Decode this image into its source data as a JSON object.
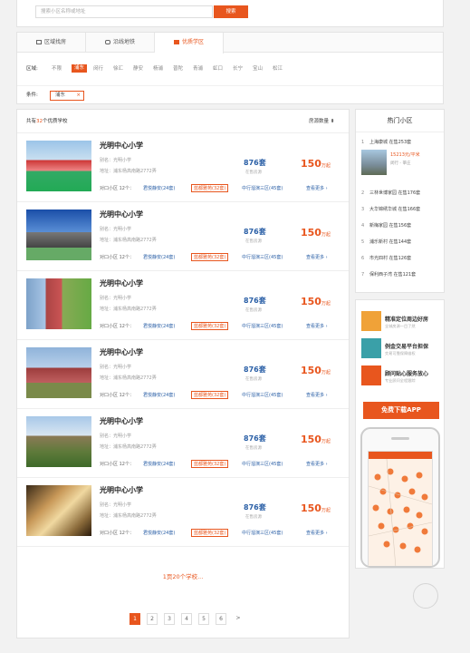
{
  "search": {
    "placeholder": "搜索小区名称或地址",
    "button": "搜索"
  },
  "tabs": [
    {
      "label": "区域找房",
      "icon": "map-icon"
    },
    {
      "label": "沿线地铁",
      "icon": "subway-icon"
    },
    {
      "label": "优质学区",
      "icon": "school-icon"
    }
  ],
  "filter": {
    "district_label": "区域:",
    "districts": [
      "不限",
      "浦东",
      "闵行",
      "徐汇",
      "静安",
      "杨浦",
      "普陀",
      "青浦",
      "虹口",
      "长宁",
      "宝山",
      "松江"
    ],
    "selected_district": "浦东",
    "condition_label": "条件:",
    "condition_tag": "浦东"
  },
  "list": {
    "count_prefix": "共有",
    "count": "32",
    "count_suffix": "个优质学校",
    "sort_label": "房源数量 ⬍",
    "more_link": "1页20个学校...",
    "pages": [
      "1",
      "2",
      "3",
      "4",
      "5",
      "6",
      ">"
    ],
    "current_page": "1",
    "items": [
      {
        "name": "光明中心小学",
        "alias": "别名：光明小学",
        "address": "地址：浦东杨高南路2772弄",
        "count": "876套",
        "count_sub": "在售房源",
        "price": "150",
        "price_unit": "万起",
        "link_label": "对口小区 12个：",
        "link1": "君悦静安(24套)",
        "link2": "蓝都雅苑(32套)",
        "link3": "中行溜演三区(45套)",
        "more": "查看更多 ›"
      },
      {
        "name": "光明中心小学",
        "alias": "别名：光明小学",
        "address": "地址：浦东杨高南路2772弄",
        "count": "876套",
        "count_sub": "在售房源",
        "price": "150",
        "price_unit": "万起",
        "link_label": "对口小区 12个：",
        "link1": "君悦静安(24套)",
        "link2": "蓝都雅苑(32套)",
        "link3": "中行溜演三区(45套)",
        "more": "查看更多 ›"
      },
      {
        "name": "光明中心小学",
        "alias": "别名：光明小学",
        "address": "地址：浦东杨高南路2772弄",
        "count": "876套",
        "count_sub": "在售房源",
        "price": "150",
        "price_unit": "万起",
        "link_label": "对口小区 12个：",
        "link1": "君悦静安(24套)",
        "link2": "蓝都雅苑(32套)",
        "link3": "中行溜演三区(45套)",
        "more": "查看更多 ›"
      },
      {
        "name": "光明中心小学",
        "alias": "别名：光明小学",
        "address": "地址：浦东杨高南路2772弄",
        "count": "876套",
        "count_sub": "在售房源",
        "price": "150",
        "price_unit": "万起",
        "link_label": "对口小区 12个：",
        "link1": "君悦静安(24套)",
        "link2": "蓝都雅苑(32套)",
        "link3": "中行溜演三区(45套)",
        "more": "查看更多 ›"
      },
      {
        "name": "光明中心小学",
        "alias": "别名：光明小学",
        "address": "地址：浦东杨高南路2772弄",
        "count": "876套",
        "count_sub": "在售房源",
        "price": "150",
        "price_unit": "万起",
        "link_label": "对口小区 12个：",
        "link1": "君悦静安(24套)",
        "link2": "蓝都雅苑(32套)",
        "link3": "中行溜演三区(45套)",
        "more": "查看更多 ›"
      },
      {
        "name": "光明中心小学",
        "alias": "别名：光明小学",
        "address": "地址：浦东杨高南路2772弄",
        "count": "876套",
        "count_sub": "在售房源",
        "price": "150",
        "price_unit": "万起",
        "link_label": "对口小区 12个：",
        "link1": "君悦静安(24套)",
        "link2": "蓝都雅苑(32套)",
        "link3": "中行溜演三区(45套)",
        "more": "查看更多 ›"
      }
    ]
  },
  "hot": {
    "title": "热门小区",
    "first": {
      "no": "1",
      "name": "上海康城",
      "count": "在售253套",
      "price": "15213元/平米",
      "meta": "闵行 - 莘庄"
    },
    "rows": [
      {
        "no": "2",
        "text": "三林世博家园  在售176套"
      },
      {
        "no": "3",
        "text": "大华锦绣华城  在售166套"
      },
      {
        "no": "4",
        "text": "新梅家园  在售156套"
      },
      {
        "no": "5",
        "text": "浦乐新村  在售144套"
      },
      {
        "no": "6",
        "text": "市光四村  在售126套"
      },
      {
        "no": "7",
        "text": "保利西子湾  在售121套"
      }
    ]
  },
  "app": {
    "features": [
      {
        "title": "精准定位周边好房",
        "sub": "全城房源一目了然",
        "icon": "location-icon",
        "color": "#f0a238"
      },
      {
        "title": "例金交易平台担保",
        "sub": "交易可靠保障维权",
        "icon": "shield-icon",
        "color": "#3aa0a8"
      },
      {
        "title": "顾问贴心服务放心",
        "sub": "专业顾问全程跟踪",
        "icon": "phone-icon",
        "color": "#e8561e"
      }
    ],
    "download": "免费下载APP"
  },
  "colors": {
    "accent": "#e8561e",
    "link": "#2a5fa6"
  }
}
